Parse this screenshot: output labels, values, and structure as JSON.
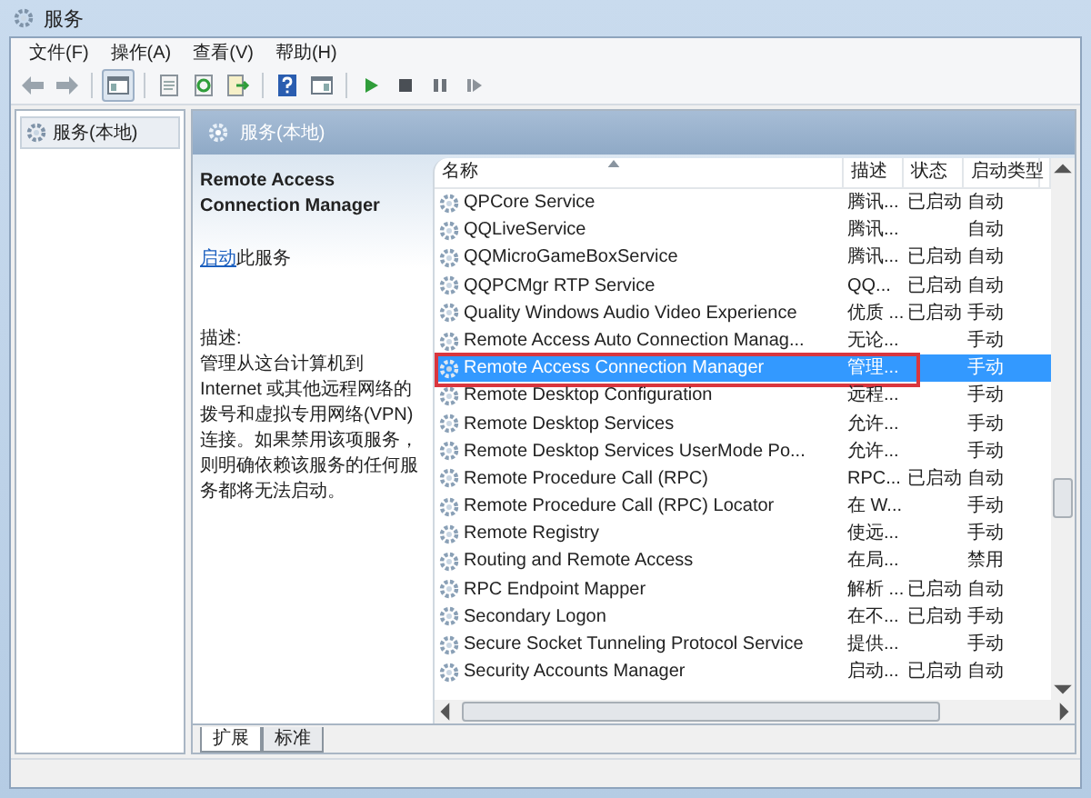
{
  "window": {
    "title": "服务"
  },
  "menu": [
    "文件(F)",
    "操作(A)",
    "查看(V)",
    "帮助(H)"
  ],
  "tree": {
    "items": [
      {
        "label": "服务(本地)",
        "selected": true
      }
    ]
  },
  "pane_header": "服务(本地)",
  "details": {
    "service_name": "Remote Access Connection Manager",
    "action_link": "启动",
    "action_text": "此服务",
    "description_label": "描述:",
    "description": "管理从这台计算机到 Internet 或其他远程网络的拨号和虚拟专用网络(VPN)连接。如果禁用该项服务，则明确依赖该服务的任何服务都将无法启动。"
  },
  "table": {
    "columns": [
      "名称",
      "描述",
      "状态",
      "启动类型"
    ],
    "rows": [
      {
        "name": "QPCore Service",
        "description": "腾讯...",
        "status": "已启动",
        "startup_type": "自动",
        "selected": false,
        "highlighted": false
      },
      {
        "name": "QQLiveService",
        "description": "腾讯...",
        "status": "",
        "startup_type": "自动",
        "selected": false,
        "highlighted": false
      },
      {
        "name": "QQMicroGameBoxService",
        "description": "腾讯...",
        "status": "已启动",
        "startup_type": "自动",
        "selected": false,
        "highlighted": false
      },
      {
        "name": "QQPCMgr RTP Service",
        "description": "QQ...",
        "status": "已启动",
        "startup_type": "自动",
        "selected": false,
        "highlighted": false
      },
      {
        "name": "Quality Windows Audio Video Experience",
        "description": "优质 ...",
        "status": "已启动",
        "startup_type": "手动",
        "selected": false,
        "highlighted": false
      },
      {
        "name": "Remote Access Auto Connection Manag...",
        "description": "无论...",
        "status": "",
        "startup_type": "手动",
        "selected": false,
        "highlighted": false
      },
      {
        "name": "Remote Access Connection Manager",
        "description": "管理...",
        "status": "",
        "startup_type": "手动",
        "selected": true,
        "highlighted": true
      },
      {
        "name": "Remote Desktop Configuration",
        "description": "远程...",
        "status": "",
        "startup_type": "手动",
        "selected": false,
        "highlighted": false
      },
      {
        "name": "Remote Desktop Services",
        "description": "允许...",
        "status": "",
        "startup_type": "手动",
        "selected": false,
        "highlighted": false
      },
      {
        "name": "Remote Desktop Services UserMode Po...",
        "description": "允许...",
        "status": "",
        "startup_type": "手动",
        "selected": false,
        "highlighted": false
      },
      {
        "name": "Remote Procedure Call (RPC)",
        "description": "RPC...",
        "status": "已启动",
        "startup_type": "自动",
        "selected": false,
        "highlighted": false
      },
      {
        "name": "Remote Procedure Call (RPC) Locator",
        "description": "在 W...",
        "status": "",
        "startup_type": "手动",
        "selected": false,
        "highlighted": false
      },
      {
        "name": "Remote Registry",
        "description": "使远...",
        "status": "",
        "startup_type": "手动",
        "selected": false,
        "highlighted": false
      },
      {
        "name": "Routing and Remote Access",
        "description": "在局...",
        "status": "",
        "startup_type": "禁用",
        "selected": false,
        "highlighted": false
      },
      {
        "name": "RPC Endpoint Mapper",
        "description": "解析 ...",
        "status": "已启动",
        "startup_type": "自动",
        "selected": false,
        "highlighted": false
      },
      {
        "name": "Secondary Logon",
        "description": "在不...",
        "status": "已启动",
        "startup_type": "手动",
        "selected": false,
        "highlighted": false
      },
      {
        "name": "Secure Socket Tunneling Protocol Service",
        "description": "提供...",
        "status": "",
        "startup_type": "手动",
        "selected": false,
        "highlighted": false
      },
      {
        "name": "Security Accounts Manager",
        "description": "启动...",
        "status": "已启动",
        "startup_type": "自动",
        "selected": false,
        "highlighted": false
      }
    ]
  },
  "tabs": [
    {
      "label": "扩展",
      "selected": true
    },
    {
      "label": "标准",
      "selected": false
    }
  ]
}
